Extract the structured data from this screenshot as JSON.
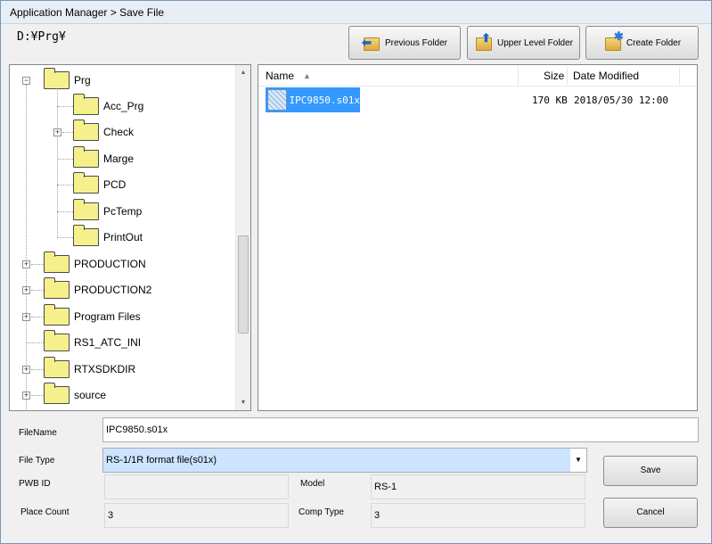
{
  "window": {
    "title": "Application Manager > Save File"
  },
  "current_path": "D:¥Prg¥",
  "toolbar": {
    "previous_folder": "Previous Folder",
    "upper_level_folder": "Upper Level Folder",
    "create_folder": "Create Folder"
  },
  "tree": {
    "root": {
      "label": "Prg"
    },
    "children": [
      {
        "label": "Acc_Prg",
        "expandable": false
      },
      {
        "label": "Check",
        "expandable": true
      },
      {
        "label": "Marge",
        "expandable": false
      },
      {
        "label": "PCD",
        "expandable": false
      },
      {
        "label": "PcTemp",
        "expandable": false
      },
      {
        "label": "PrintOut",
        "expandable": false
      }
    ],
    "siblings": [
      {
        "label": "PRODUCTION",
        "expandable": true
      },
      {
        "label": "PRODUCTION2",
        "expandable": true
      },
      {
        "label": "Program Files",
        "expandable": true
      },
      {
        "label": "RS1_ATC_INI",
        "expandable": false
      },
      {
        "label": "RTXSDKDIR",
        "expandable": true
      },
      {
        "label": "source",
        "expandable": true
      }
    ]
  },
  "filelist": {
    "columns": {
      "name": "Name",
      "size": "Size",
      "date": "Date Modified"
    },
    "files": [
      {
        "name": "IPC9850.s01x",
        "size": "170 KB",
        "date": "2018/05/30 12:00"
      }
    ]
  },
  "form": {
    "filename_label": "FileName",
    "filename_value": "IPC9850.s01x",
    "filetype_label": "File Type",
    "filetype_value": "RS-1/1R format file(s01x)",
    "pwb_id_label": "PWB ID",
    "pwb_id_value": "",
    "model_label": "Model",
    "model_value": "RS-1",
    "place_count_label": "Place Count",
    "place_count_value": "3",
    "comp_type_label": "Comp Type",
    "comp_type_value": "3"
  },
  "actions": {
    "save": "Save",
    "cancel": "Cancel"
  },
  "icons": {
    "previous_folder": "folder-back-arrow-icon",
    "upper_level_folder": "folder-up-arrow-icon",
    "create_folder": "folder-new-icon",
    "tree_folder": "folder-icon",
    "file": "file-icon",
    "sort": "sort-ascending-icon",
    "dropdown": "chevron-down-icon"
  },
  "colors": {
    "selection": "#3399ff",
    "folder_fill": "#f5f08c",
    "dropdown_highlight": "#cce4ff"
  }
}
